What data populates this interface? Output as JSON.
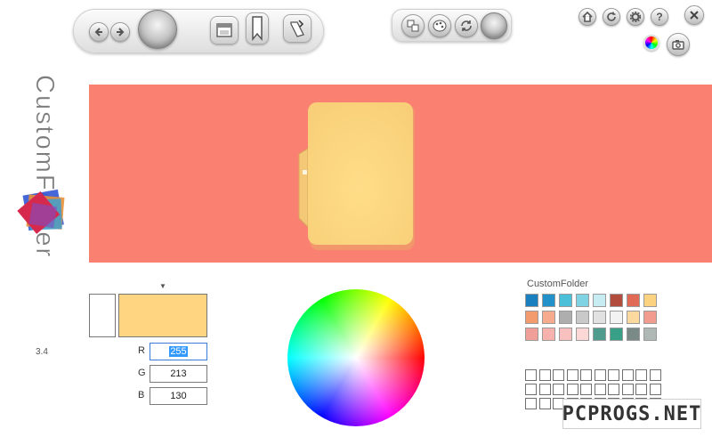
{
  "app": {
    "title": "CustomFolder",
    "version": "3.4"
  },
  "toolbar": {
    "group1": [
      "back-icon",
      "forward-icon",
      "apply-orb",
      "window-icon",
      "bookmark-icon",
      "folder-paint-icon"
    ],
    "group2": [
      "emblem-icon",
      "palette-icon",
      "refresh-arrows-icon",
      "apply-orb"
    ],
    "system": [
      "home-icon",
      "refresh-icon",
      "settings-icon",
      "help-icon",
      "close-icon",
      "color-picker-icon",
      "screenshot-icon"
    ]
  },
  "preview": {
    "background_color": "#fa8072",
    "folder_color": "#ffd582"
  },
  "color": {
    "old_swatch": "#ffffff",
    "new_swatch": "#ffd582",
    "r_label": "R",
    "g_label": "G",
    "b_label": "B",
    "r": "255",
    "g": "213",
    "b": "130",
    "marker": "▼"
  },
  "palette": {
    "title": "CustomFolder",
    "rows": [
      [
        "#1a7fbe",
        "#2291c9",
        "#4cc0d8",
        "#7fd3e3",
        "#c7ecf2",
        "#b24d3d",
        "#e06a55",
        "#fbd280"
      ],
      [
        "#f49b6e",
        "#f6ab8f",
        "#aeaeae",
        "#c9c9c9",
        "#e1e1e1",
        "#f3f3f3",
        "#fcd99f",
        "#f19c8e"
      ],
      [
        "#ef9f97",
        "#f7b2ad",
        "#f8c0be",
        "#fbd7d5",
        "#4f9b8e",
        "#38a086",
        "#7a8a86",
        "#b0b8b5"
      ]
    ],
    "custom_rows": 3,
    "custom_cols": 10
  },
  "watermark": {
    "text": "PCPROGS.NET"
  }
}
